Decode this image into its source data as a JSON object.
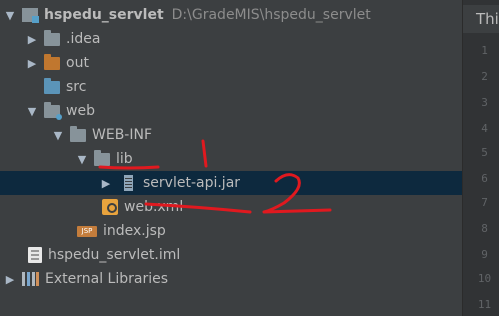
{
  "project": {
    "name": "hspedu_servlet",
    "path": "D:\\GradeMIS\\hspedu_servlet"
  },
  "tree": {
    "idea": ".idea",
    "out": "out",
    "src": "src",
    "web": "web",
    "webinf": "WEB-INF",
    "lib": "lib",
    "servlet_jar": "servlet-api.jar",
    "web_xml": "web.xml",
    "index_jsp": "index.jsp",
    "iml": "hspedu_servlet.iml",
    "external": "External Libraries"
  },
  "icons": {
    "jsp_badge": "JSP"
  },
  "editor": {
    "tab_title": "Thi",
    "line_numbers": [
      "1",
      "2",
      "3",
      "4",
      "5",
      "6",
      "7",
      "8",
      "9",
      "10",
      "11"
    ]
  },
  "annotations": {
    "mark_1": "1",
    "mark_2": "2",
    "color": "#e0191f"
  },
  "colors": {
    "tree_bg": "#3c3f41",
    "selection": "#0d293e",
    "gutter_bg": "#313335"
  }
}
